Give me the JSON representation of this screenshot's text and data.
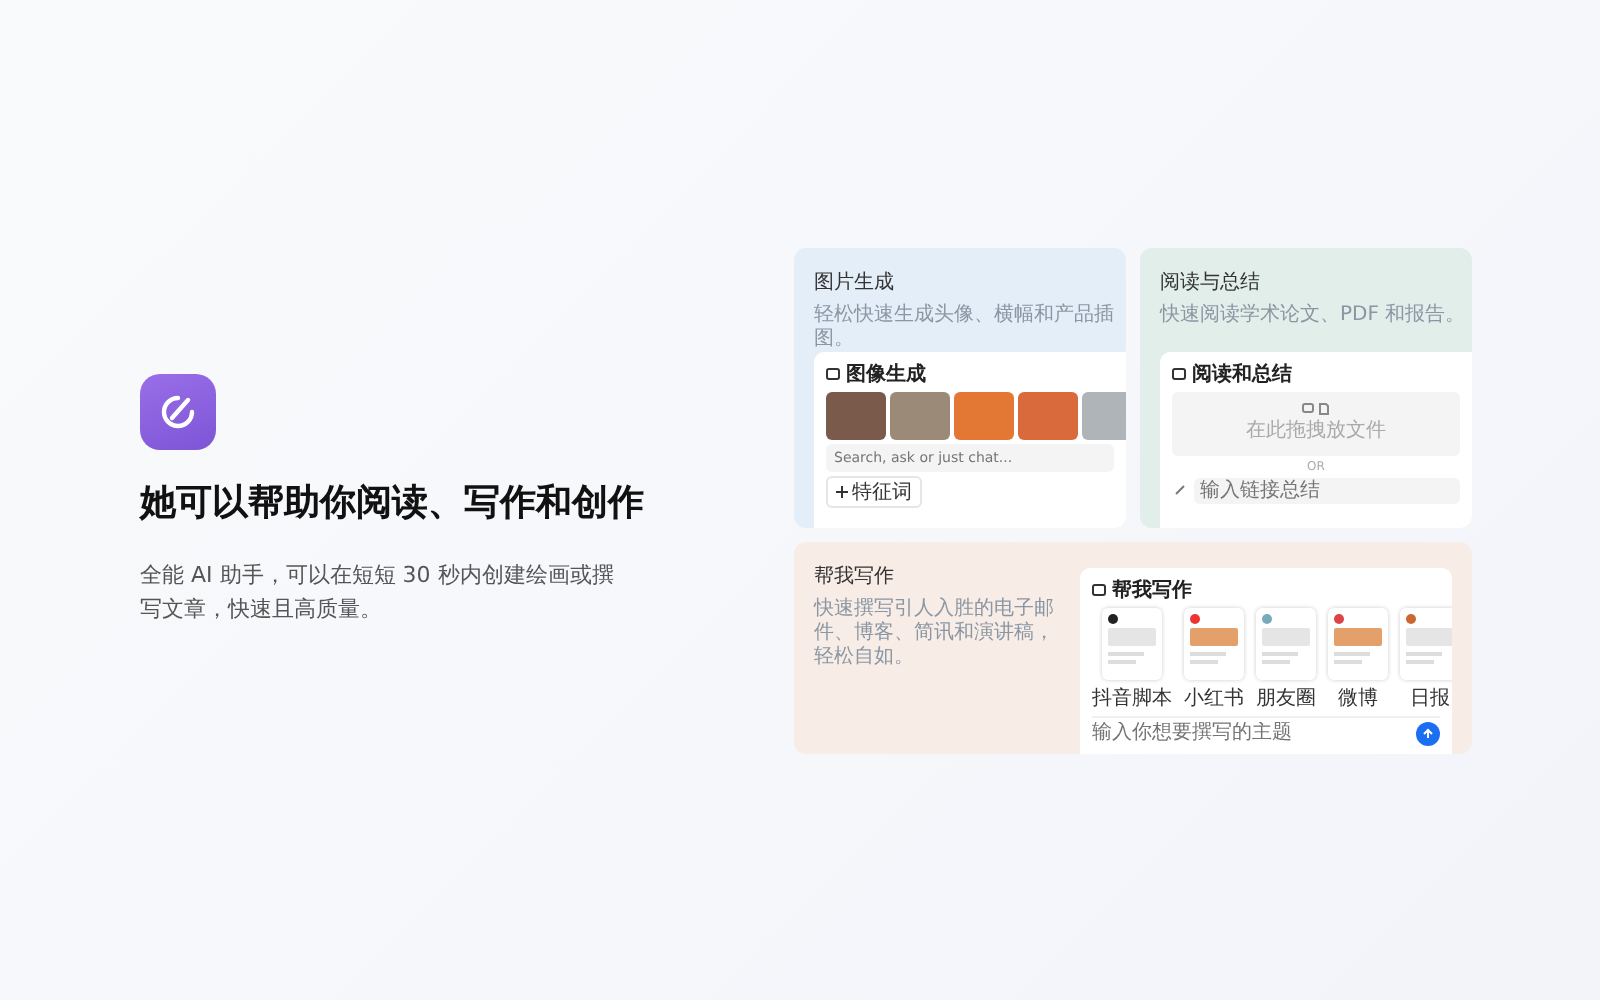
{
  "hero": {
    "title": "她可以帮助你阅读、写作和创作",
    "description": "全能 AI 助手，可以在短短 30 秒内创建绘画或撰写文章，快速且高质量。"
  },
  "cards": [
    {
      "kind": "image",
      "title": "图片生成",
      "subtitle": "轻松快速生成头像、横幅和产品插图。",
      "panel": {
        "title": "图像生成",
        "placeholder": "Search, ask or just chat...",
        "chip": "特征词"
      }
    },
    {
      "kind": "read",
      "title": "阅读与总结",
      "subtitle": "快速阅读学术论文、PDF 和报告。",
      "panel": {
        "title": "阅读和总结",
        "drop_hint": "在此拖拽放文件",
        "divider": "OR",
        "placeholder": "输入链接总结"
      }
    },
    {
      "kind": "write",
      "title": "帮我写作",
      "subtitle": "快速撰写引人入胜的电子邮件、博客、简讯和演讲稿，轻松自如。",
      "panel": {
        "title": "帮我写作",
        "placeholder": "输入你想要撰写的主题",
        "templates": [
          "抖音脚本",
          "小红书",
          "朋友圈",
          "微博",
          "日报"
        ]
      }
    }
  ]
}
